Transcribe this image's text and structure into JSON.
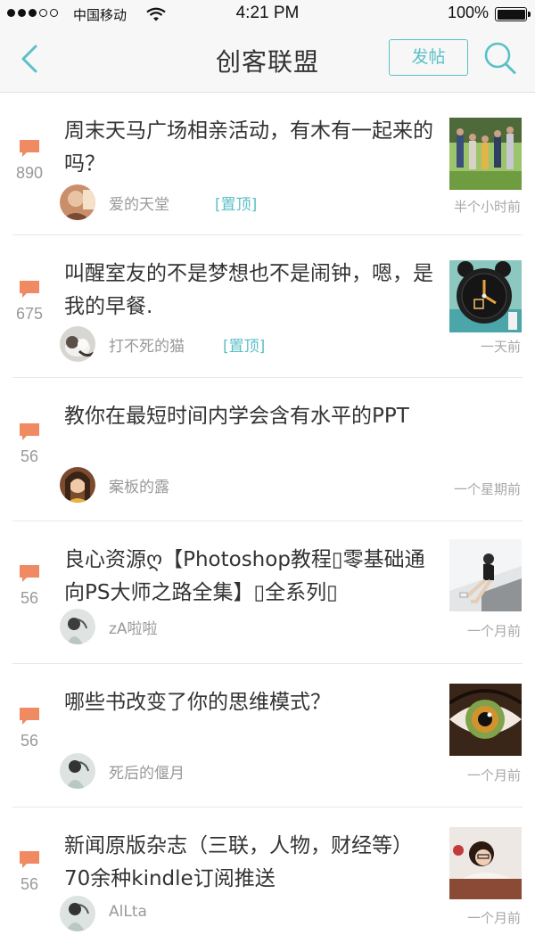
{
  "status_bar": {
    "carrier": "中国移动",
    "time": "4:21 PM",
    "battery": "100%",
    "battery_level": 1.0
  },
  "nav": {
    "title": "创客联盟",
    "post_button": "发帖",
    "back_icon": "chevron-left-icon",
    "search_icon": "search-icon"
  },
  "colors": {
    "accent": "#5bc0c7",
    "comment_icon": "#ef8a63"
  },
  "posts": [
    {
      "title": "周末天马广场相亲活动，有木有一起来的吗？",
      "comments": "890",
      "author": "爱的天堂",
      "pinned": "[置顶]",
      "time": "半个小时前",
      "has_thumb": true
    },
    {
      "title": "叫醒室友的不是梦想也不是闹钟，嗯，是我的早餐.",
      "comments": "675",
      "author": "打不死的猫",
      "pinned": "[置顶]",
      "time": "一天前",
      "has_thumb": true
    },
    {
      "title": "教你在最短时间内学会含有水平的PPT",
      "comments": "56",
      "author": "案板的露",
      "pinned": "",
      "time": "一个星期前",
      "has_thumb": false
    },
    {
      "title": "良心资源ღ【Photoshop教程▯零基础通向PS大师之路全集】▯全系列▯",
      "comments": "56",
      "author": "zA啦啦",
      "pinned": "",
      "time": "一个月前",
      "has_thumb": true
    },
    {
      "title": "哪些书改变了你的思维模式？",
      "comments": "56",
      "author": "死后的偃月",
      "pinned": "",
      "time": "一个月前",
      "has_thumb": true
    },
    {
      "title": "新闻原版杂志（三联，人物，财经等）70余种kindle订阅推送",
      "comments": "56",
      "author": "AlLta",
      "pinned": "",
      "time": "一个月前",
      "has_thumb": true
    }
  ]
}
